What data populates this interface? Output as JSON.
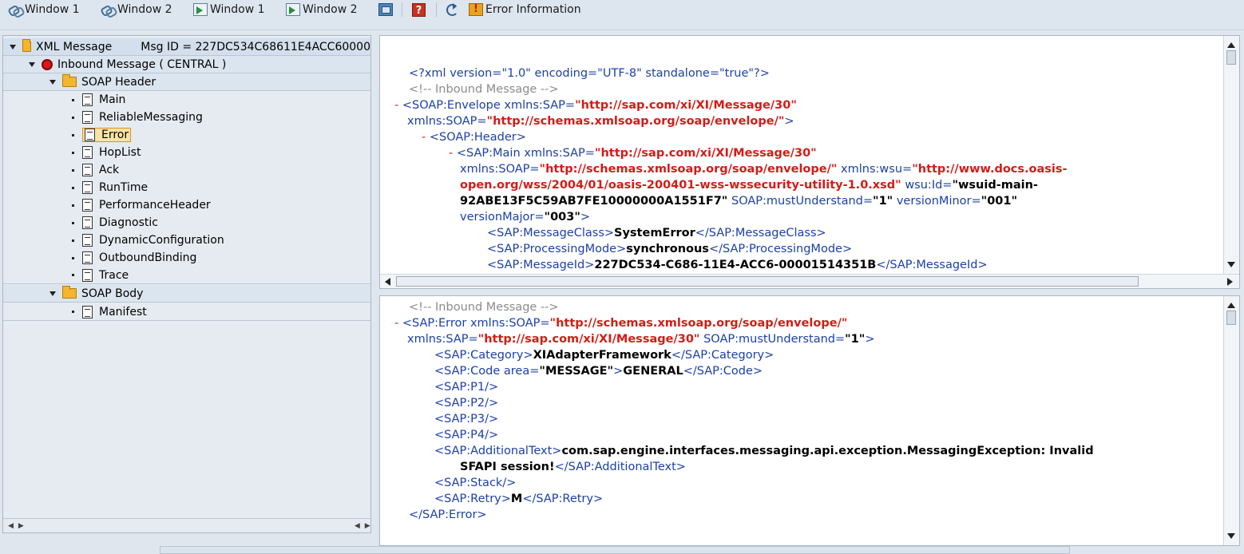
{
  "toolbar": {
    "buttons": [
      {
        "label": "Window 1",
        "icon": "link-windows-icon"
      },
      {
        "label": "Window 2",
        "icon": "link-windows-icon"
      },
      {
        "label": "Window 1",
        "icon": "window-doc-icon"
      },
      {
        "label": "Window 2",
        "icon": "window-doc-icon"
      },
      {
        "label": "",
        "icon": "window-square-icon"
      },
      {
        "label": "",
        "icon": "help-icon"
      },
      {
        "label": "",
        "icon": "refresh-icon"
      },
      {
        "label": "Error Information",
        "icon": "error-info-icon"
      }
    ]
  },
  "tree": {
    "root_label": "XML Message",
    "msg_id": "Msg ID =  227DC534C68611E4ACC60000",
    "inbound": "Inbound Message ( CENTRAL )",
    "soap_header": "SOAP Header",
    "header_items": [
      "Main",
      "ReliableMessaging",
      "Error",
      "HopList",
      "Ack",
      "RunTime",
      "PerformanceHeader",
      "Diagnostic",
      "DynamicConfiguration",
      "OutboundBinding",
      "Trace"
    ],
    "selected": "Error",
    "soap_body": "SOAP Body",
    "body_items": [
      "Manifest"
    ]
  },
  "xml_top": {
    "pi": "<?xml version=\"1.0\" encoding=\"UTF-8\" standalone=\"true\"?>",
    "comment": "<!-- Inbound Message -->",
    "envelope_open": "<SOAP:Envelope ",
    "envelope_attr1": "xmlns:SAP=",
    "envelope_val1": "\"http://sap.com/xi/XI/Message/30\"",
    "envelope_attr2": "xmlns:SOAP=",
    "envelope_val2": "\"http://schemas.xmlsoap.org/soap/envelope/\"",
    "envelope_close": ">",
    "header_tag": "<SOAP:Header>",
    "main_open": "<SAP:Main ",
    "main_attr1": "xmlns:SAP=",
    "main_val1": "\"http://sap.com/xi/XI/Message/30\"",
    "main_attr2": "xmlns:SOAP=",
    "main_val2": "\"http://schemas.xmlsoap.org/soap/envelope/\"",
    "main_attr3": " xmlns:wsu=",
    "main_val3a": "\"http://www.docs.oasis-",
    "main_val3b": "open.org/wss/2004/01/oasis-200401-wss-wssecurity-utility-1.0.xsd\"",
    "main_attr4": " wsu:Id=",
    "main_val4a": "\"wsuid-main-",
    "main_val4b": "92ABE13F5C59AB7FE10000000A1551F7\"",
    "main_attr5": " SOAP:mustUnderstand=",
    "main_val5": "\"1\"",
    "main_attr6": " versionMinor=",
    "main_val6": "\"001\"",
    "main_attr7": "versionMajor=",
    "main_val7": "\"003\"",
    "main_close": ">",
    "mc_open": "<SAP:MessageClass>",
    "mc_text": "SystemError",
    "mc_close": "</SAP:MessageClass>",
    "pm_open": "<SAP:ProcessingMode>",
    "pm_text": "synchronous",
    "pm_close": "</SAP:ProcessingMode>",
    "mid_open": "<SAP:MessageId>",
    "mid_text": "227DC534-C686-11E4-ACC6-00001514351B",
    "mid_close": "</SAP:MessageId>"
  },
  "xml_bottom": {
    "comment": "<!-- Inbound Message -->",
    "err_open": "<SAP:Error ",
    "err_attr1": "xmlns:SOAP=",
    "err_val1": "\"http://schemas.xmlsoap.org/soap/envelope/\"",
    "err_attr2": "xmlns:SAP=",
    "err_val2": "\"http://sap.com/xi/XI/Message/30\"",
    "err_attr3": " SOAP:mustUnderstand=",
    "err_val3": "\"1\"",
    "err_close": ">",
    "cat_open": "<SAP:Category>",
    "cat_text": "XIAdapterFramework",
    "cat_close": "</SAP:Category>",
    "code_open": "<SAP:Code ",
    "code_attr": "area=",
    "code_val": "\"MESSAGE\"",
    "code_gt": ">",
    "code_text": "GENERAL",
    "code_close": "</SAP:Code>",
    "p1": "<SAP:P1/>",
    "p2": "<SAP:P2/>",
    "p3": "<SAP:P3/>",
    "p4": "<SAP:P4/>",
    "at_open": "<SAP:AdditionalText>",
    "at_text1": "com.sap.engine.interfaces.messaging.api.exception.MessagingException: Invalid",
    "at_text2": "SFAPI session!",
    "at_close": "</SAP:AdditionalText>",
    "stack": "<SAP:Stack/>",
    "retry_open": "<SAP:Retry>",
    "retry_text": "M",
    "retry_close": "</SAP:Retry>",
    "err_end": "</SAP:Error>"
  },
  "minus": "-",
  "colors": {
    "tag": "#1b3fa8",
    "value": "#d41c16",
    "comment": "#8b8b8b",
    "selection": "#fbe3a3"
  }
}
